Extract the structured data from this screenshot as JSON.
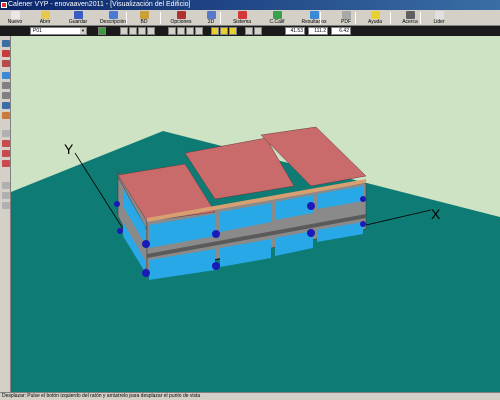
{
  "window": {
    "title": "Calener VYP - enovaaven2011 - [Visualización del Edificio]"
  },
  "toolbar": {
    "buttons": [
      {
        "label": "Nuevo",
        "icon": "new-file-icon",
        "color": "#e8e8e8"
      },
      {
        "label": "Abrir",
        "icon": "open-folder-icon",
        "color": "#e8c84a"
      },
      {
        "label": "Guardar",
        "icon": "save-disk-icon",
        "color": "#3a5bbf"
      },
      {
        "label": "Descripción",
        "icon": "description-icon",
        "color": "#4a7bd4"
      },
      {
        "label": "BD",
        "icon": "database-icon",
        "color": "#c9a13a"
      },
      {
        "label": "Opciones",
        "icon": "options-icon",
        "color": "#b03030"
      },
      {
        "label": "3D",
        "icon": "3d-view-icon",
        "color": "#5a78c8"
      },
      {
        "label": "Sistema",
        "icon": "system-icon",
        "color": "#d23a3a"
      },
      {
        "label": "C.Calif",
        "icon": "calification-icon",
        "color": "#3aa04a"
      },
      {
        "label": "Resultados",
        "icon": "results-icon",
        "color": "#3a8ad8"
      },
      {
        "label": "PDF",
        "icon": "pdf-icon",
        "color": "#a8a8a8"
      },
      {
        "label": "Ayuda",
        "icon": "help-icon",
        "color": "#e8d030"
      },
      {
        "label": "Acerca",
        "icon": "about-icon",
        "color": "#606060"
      },
      {
        "label": "Lider",
        "icon": "lider-icon",
        "color": "#e0e0e0"
      }
    ]
  },
  "toolbar2": {
    "plant_value": "P01",
    "num1": "41.53",
    "num2": "111.2",
    "num3": "6.42"
  },
  "viewport": {
    "axis_y_label": "Y",
    "axis_x_label": "X",
    "sky_color": "#cde3c4",
    "ground_color": "#0e7b75",
    "wall_color": "#8a8a8a",
    "window_color": "#29a8e8",
    "roof_color": "#c96b6b"
  },
  "status": {
    "text": "Desplazar: Pulse el botón izquierdo del ratón y arrástrelo para desplazar el punto de vista"
  }
}
